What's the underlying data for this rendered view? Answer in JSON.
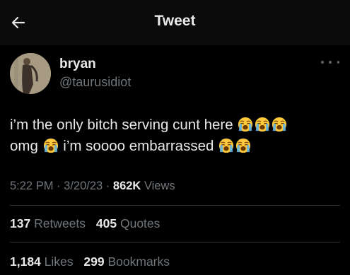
{
  "header": {
    "back_icon": "arrow-left-icon",
    "title": "Tweet"
  },
  "author": {
    "name": "bryan",
    "handle": "@taurusidiot",
    "more_icon": "more-horizontal-icon"
  },
  "tweet": {
    "line1_text": "i’m the only bitch serving cunt here",
    "line2_word": "omg",
    "line2_text": "i’m soooo embarrassed",
    "emoji": "loudly-crying-face"
  },
  "meta": {
    "time": "5:22 PM",
    "sep1": "·",
    "date": "3/20/23",
    "sep2": "·",
    "views_count": "862K",
    "views_label": "Views"
  },
  "stats": {
    "retweets_count": "137",
    "retweets_label": "Retweets",
    "quotes_count": "405",
    "quotes_label": "Quotes",
    "likes_count": "1,184",
    "likes_label": "Likes",
    "bookmarks_count": "299",
    "bookmarks_label": "Bookmarks"
  },
  "colors": {
    "background": "#000000",
    "header_bg": "#0b0b0b",
    "text_primary": "#e7e9ea",
    "text_secondary": "#71767b",
    "divider": "#2f3336",
    "emoji_face": "#ffc83d",
    "emoji_tears": "#5fb3e6"
  }
}
